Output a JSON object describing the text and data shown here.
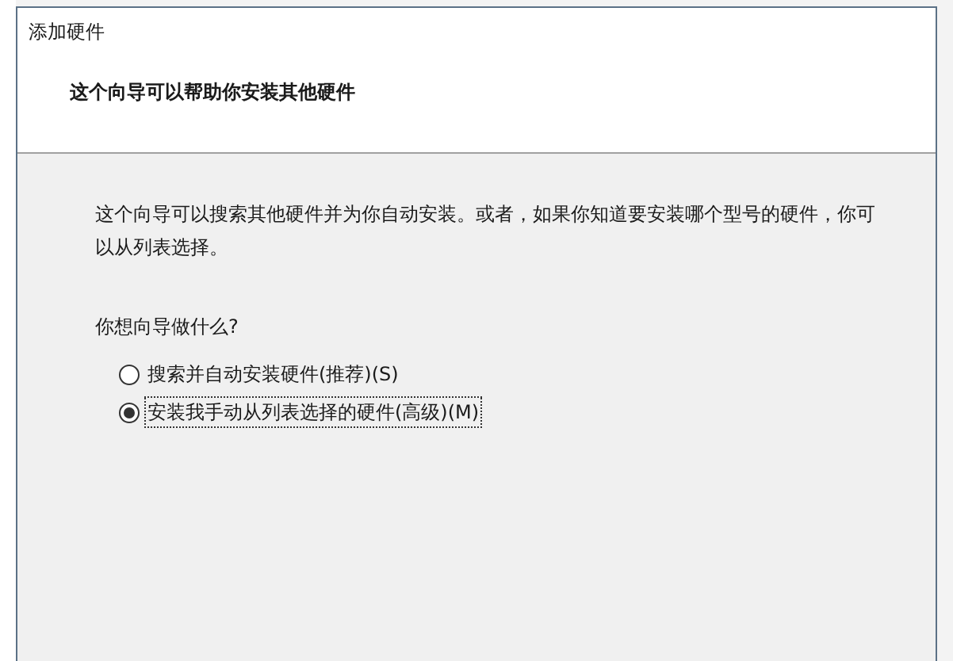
{
  "window": {
    "title": "添加硬件"
  },
  "header": {
    "heading": "这个向导可以帮助你安装其他硬件"
  },
  "body": {
    "description": "这个向导可以搜索其他硬件并为你自动安装。或者，如果你知道要安装哪个型号的硬件，你可以从列表选择。",
    "question": "你想向导做什么?"
  },
  "options": [
    {
      "label": "搜索并自动安装硬件(推荐)(S)",
      "selected": false
    },
    {
      "label": "安装我手动从列表选择的硬件(高级)(M)",
      "selected": true
    }
  ]
}
